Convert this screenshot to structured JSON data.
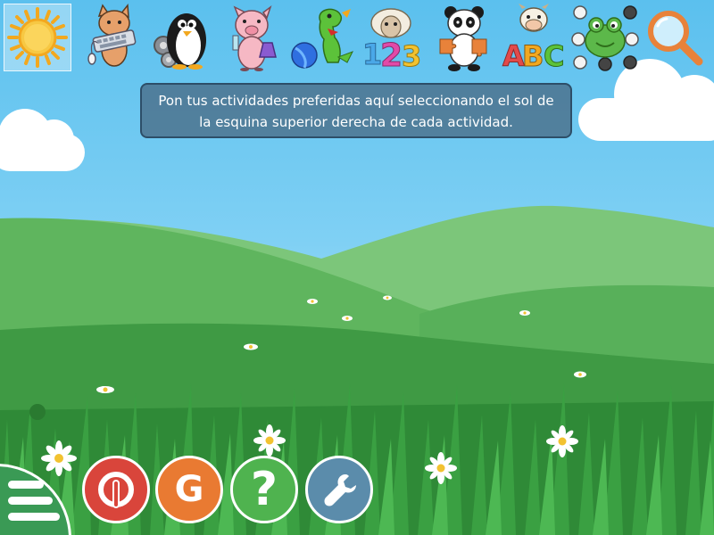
{
  "colors": {
    "sky_top": "#5bc0ee",
    "hill_light": "#7cc67a",
    "hill_mid": "#58b05a",
    "grass_dark": "#2f8a37",
    "exit_button": "#d9453b",
    "gcompris_button": "#e97a32",
    "help_button": "#4fb34f",
    "config_button": "#5b8cab",
    "menu_button": "#3a9a55"
  },
  "activity_bar": {
    "items": [
      {
        "icon": "sun-icon",
        "selected": true
      },
      {
        "icon": "cat-keyboard-icon",
        "selected": false
      },
      {
        "icon": "penguin-gears-icon",
        "selected": false
      },
      {
        "icon": "pig-scientist-icon",
        "selected": false
      },
      {
        "icon": "dinosaur-ball-icon",
        "selected": false
      },
      {
        "icon": "sheep-numbers-icon",
        "selected": false
      },
      {
        "icon": "panda-puzzle-icon",
        "selected": false
      },
      {
        "icon": "cow-letters-icon",
        "selected": false
      },
      {
        "icon": "frog-dots-icon",
        "selected": false
      },
      {
        "icon": "magnifier-icon",
        "selected": false
      }
    ],
    "numbers_label": "123",
    "letters_label": "ABC"
  },
  "message": {
    "text": "Pon tus actividades preferidas aquí seleccionando el sol de la esquina superior derecha de cada actividad."
  },
  "controls": {
    "menu_icon": "hamburger-menu-icon",
    "exit_icon": "power-icon",
    "gcompris_label": "G",
    "help_label": "?",
    "config_icon": "wrench-icon"
  }
}
